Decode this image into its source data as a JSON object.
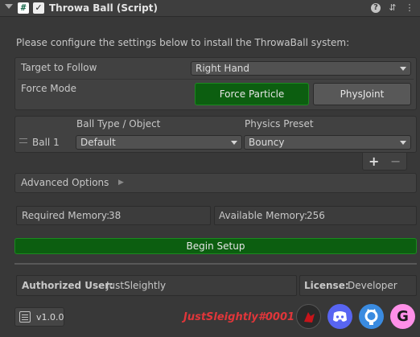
{
  "header": {
    "title": "Throwa Ball (Script)",
    "script_icon": "#",
    "check": "✓",
    "help_icon": "?",
    "settings_icon": "⇵",
    "menu_icon": "⋮"
  },
  "intro": "Please configure the settings below to install the ThrowaBall system:",
  "target": {
    "label": "Target to Follow",
    "value": "Right Hand"
  },
  "force": {
    "label": "Force Mode",
    "option_active": "Force Particle",
    "option_inactive": "PhysJoint"
  },
  "balls": {
    "col_type": "Ball Type / Object",
    "col_preset": "Physics Preset",
    "rows": [
      {
        "name": "Ball 1",
        "type": "Default",
        "preset": "Bouncy"
      }
    ],
    "add": "+",
    "remove": "−"
  },
  "advanced": {
    "label": "Advanced Options",
    "arrow": "▶"
  },
  "memory": {
    "required_label": "Required Memory:",
    "required_value": "38",
    "available_label": "Available Memory:",
    "available_value": "256"
  },
  "setup_button": "Begin Setup",
  "user": {
    "label": "Authorized User:",
    "value": "JustSleightly"
  },
  "license": {
    "label": "License:",
    "value": "Developer"
  },
  "footer": {
    "version": "v1.0.0",
    "author_tag": "JustSleightly#0001",
    "colors": {
      "author": "#e0363a",
      "discord": "#5865f2",
      "github": "#3a8be0",
      "gumroad": "#ff90e8",
      "vrc": "#2a2a2a"
    }
  },
  "icons": [
    "unity-script-icon",
    "checkbox-icon",
    "help-icon",
    "presets-icon",
    "context-menu-icon",
    "document-icon",
    "vrc-avatar-icon",
    "discord-icon",
    "github-icon",
    "gumroad-icon"
  ]
}
